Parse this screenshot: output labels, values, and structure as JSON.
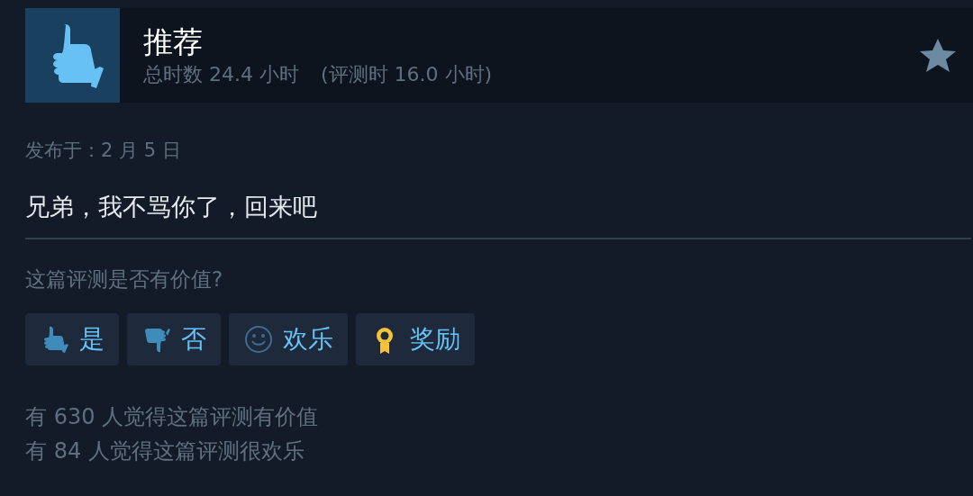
{
  "header": {
    "title": "推荐",
    "playtime": "总时数 24.4 小时",
    "review_time": "(评测时 16.0 小时)"
  },
  "posted": "发布于：2 月 5 日",
  "review_text": "兄弟，我不骂你了，回来吧",
  "question": "这篇评测是否有价值?",
  "buttons": [
    {
      "kind": "yes",
      "label": "是"
    },
    {
      "kind": "no",
      "label": "否"
    },
    {
      "kind": "funny",
      "label": "欢乐"
    },
    {
      "kind": "award",
      "label": "奖励"
    }
  ],
  "stats": [
    "有 630 人觉得这篇评测有价值",
    "有 84 人觉得这篇评测很欢乐"
  ]
}
